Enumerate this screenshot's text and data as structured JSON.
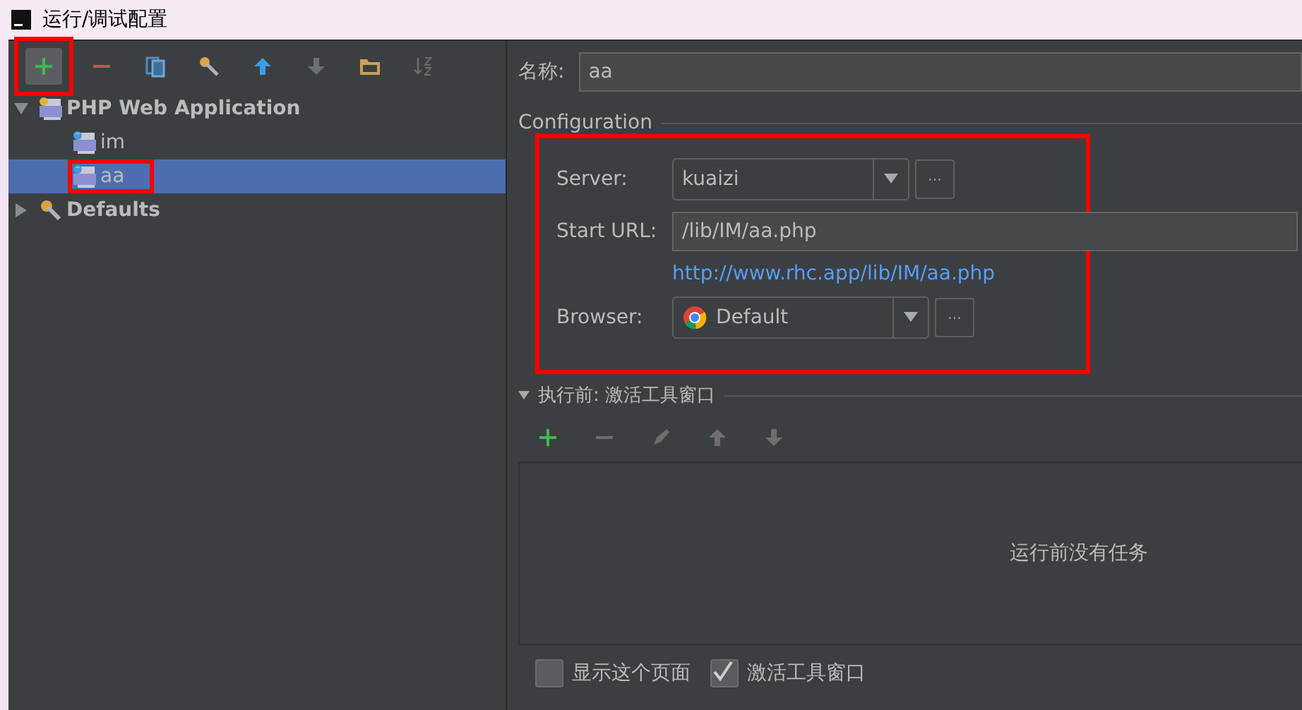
{
  "window": {
    "title": "运行/调试配置"
  },
  "toolbar": [
    {
      "kind": "add",
      "highlighted": true,
      "disabled": false
    },
    {
      "kind": "remove",
      "disabled": false
    },
    {
      "kind": "copy",
      "disabled": false
    },
    {
      "kind": "edit",
      "disabled": false
    },
    {
      "kind": "up",
      "disabled": false
    },
    {
      "kind": "down",
      "disabled": true
    },
    {
      "kind": "folder",
      "disabled": false
    },
    {
      "kind": "sort",
      "disabled": true
    }
  ],
  "tree": [
    {
      "label": "PHP Web Application",
      "kind": "php-group",
      "expanded": true,
      "selected": false,
      "children": [
        {
          "label": "im",
          "kind": "php-config",
          "selected": false
        },
        {
          "label": "aa",
          "kind": "php-config",
          "selected": true,
          "highlighted": true
        }
      ]
    },
    {
      "label": "Defaults",
      "kind": "defaults",
      "expanded": false,
      "selected": false
    }
  ],
  "name_field": {
    "label": "名称:",
    "value": "aa"
  },
  "configuration": {
    "title": "Configuration",
    "highlighted": true,
    "server": {
      "label": "Server:",
      "value": "kuaizi",
      "more": "···"
    },
    "start_url": {
      "label": "Start URL:",
      "value": "/lib/IM/aa.php"
    },
    "url_link": "http://www.rhc.app/lib/IM/aa.php",
    "browser": {
      "label": "Browser:",
      "value": "Default",
      "more": "···"
    }
  },
  "before_launch": {
    "title": "执行前: 激活工具窗口",
    "expanded": true,
    "toolbar": [
      {
        "kind": "add",
        "disabled": false
      },
      {
        "kind": "remove",
        "disabled": true
      },
      {
        "kind": "edit",
        "disabled": true
      },
      {
        "kind": "up",
        "disabled": true
      },
      {
        "kind": "down",
        "disabled": true
      }
    ],
    "empty_text": "运行前没有任务"
  },
  "options": [
    {
      "label": "显示这个页面",
      "checked": false
    },
    {
      "label": "激活工具窗口",
      "checked": true
    }
  ]
}
